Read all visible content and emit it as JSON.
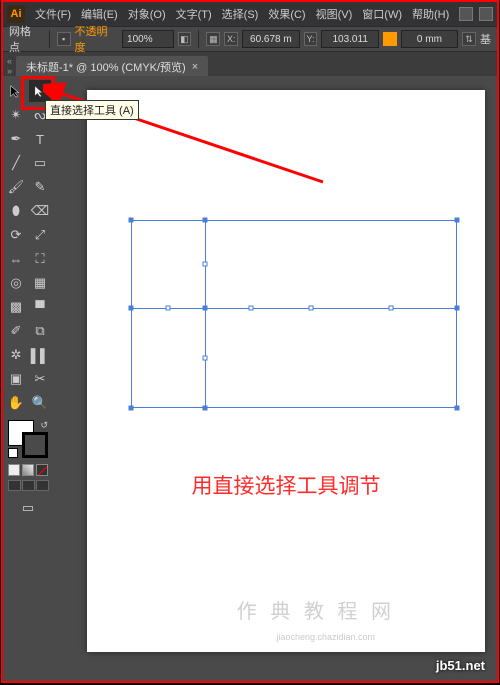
{
  "app": {
    "logo_text": "Ai"
  },
  "menu": {
    "file": "文件(F)",
    "edit": "编辑(E)",
    "object": "对象(O)",
    "type": "文字(T)",
    "select": "选择(S)",
    "effect": "效果(C)",
    "view": "视图(V)",
    "window": "窗口(W)",
    "help": "帮助(H)"
  },
  "ctrl": {
    "grid_label": "网格点",
    "opacity_link": "不透明度",
    "zoom_value": "100%",
    "x_value": "60.678 m",
    "y_value": "103.011",
    "w_value": "0 mm",
    "section_label": "基"
  },
  "tab": {
    "title": "未标题-1* @ 100% (CMYK/预览)",
    "close": "×"
  },
  "tools": {
    "tooltip_text": "直接选择工具 (A)"
  },
  "canvas": {
    "instruction": "用直接选择工具调节"
  },
  "watermark": {
    "faint1": "作 典   教 程 网",
    "faint2": "jiaocheng.chazidian.com",
    "corner": "jb51.net"
  }
}
